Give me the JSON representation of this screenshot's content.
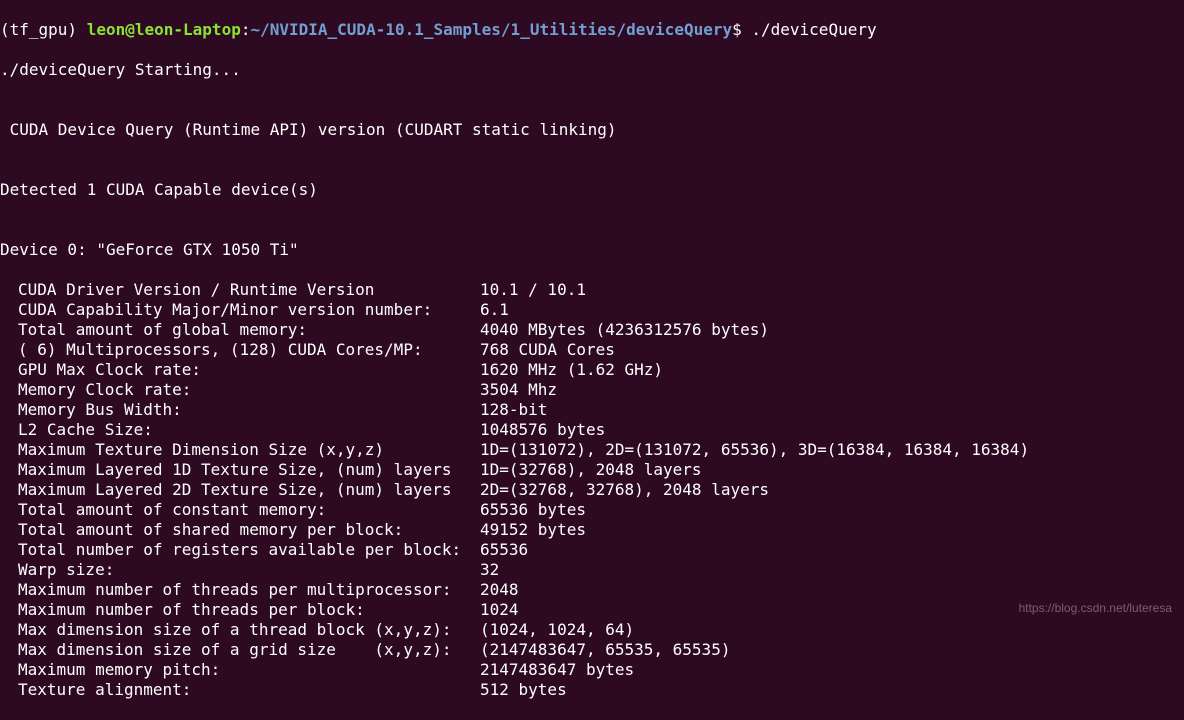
{
  "prompt": {
    "env": "(tf_gpu) ",
    "userhost": "leon@leon-Laptop",
    "colon": ":",
    "path": "~/NVIDIA_CUDA-10.1_Samples/1_Utilities/deviceQuery",
    "dollar": "$ ",
    "command": "./deviceQuery"
  },
  "lines": {
    "starting": "./deviceQuery Starting...",
    "blank": "",
    "header1": " CUDA Device Query (Runtime API) version (CUDART static linking)",
    "detected": "Detected 1 CUDA Capable device(s)",
    "device": "Device 0: \"GeForce GTX 1050 Ti\""
  },
  "kv": [
    {
      "k": "CUDA Driver Version / Runtime Version",
      "v": "10.1 / 10.1"
    },
    {
      "k": "CUDA Capability Major/Minor version number:",
      "v": "6.1"
    },
    {
      "k": "Total amount of global memory:",
      "v": "4040 MBytes (4236312576 bytes)"
    },
    {
      "k": "( 6) Multiprocessors, (128) CUDA Cores/MP:",
      "v": "768 CUDA Cores"
    },
    {
      "k": "GPU Max Clock rate:",
      "v": "1620 MHz (1.62 GHz)"
    },
    {
      "k": "Memory Clock rate:",
      "v": "3504 Mhz"
    },
    {
      "k": "Memory Bus Width:",
      "v": "128-bit"
    },
    {
      "k": "L2 Cache Size:",
      "v": "1048576 bytes"
    },
    {
      "k": "Maximum Texture Dimension Size (x,y,z)",
      "v": "1D=(131072), 2D=(131072, 65536), 3D=(16384, 16384, 16384)"
    },
    {
      "k": "Maximum Layered 1D Texture Size, (num) layers",
      "v": "1D=(32768), 2048 layers"
    },
    {
      "k": "Maximum Layered 2D Texture Size, (num) layers",
      "v": "2D=(32768, 32768), 2048 layers"
    },
    {
      "k": "Total amount of constant memory:",
      "v": "65536 bytes"
    },
    {
      "k": "Total amount of shared memory per block:",
      "v": "49152 bytes"
    },
    {
      "k": "Total number of registers available per block:",
      "v": "65536"
    },
    {
      "k": "Warp size:",
      "v": "32"
    },
    {
      "k": "Maximum number of threads per multiprocessor:",
      "v": "2048"
    },
    {
      "k": "Maximum number of threads per block:",
      "v": "1024"
    },
    {
      "k": "Max dimension size of a thread block (x,y,z):",
      "v": "(1024, 1024, 64)"
    },
    {
      "k": "Max dimension size of a grid size    (x,y,z):",
      "v": "(2147483647, 65535, 65535)"
    },
    {
      "k": "Maximum memory pitch:",
      "v": "2147483647 bytes"
    },
    {
      "k": "Texture alignment:",
      "v": "512 bytes"
    }
  ],
  "watermark": "https://blog.csdn.net/luteresa"
}
